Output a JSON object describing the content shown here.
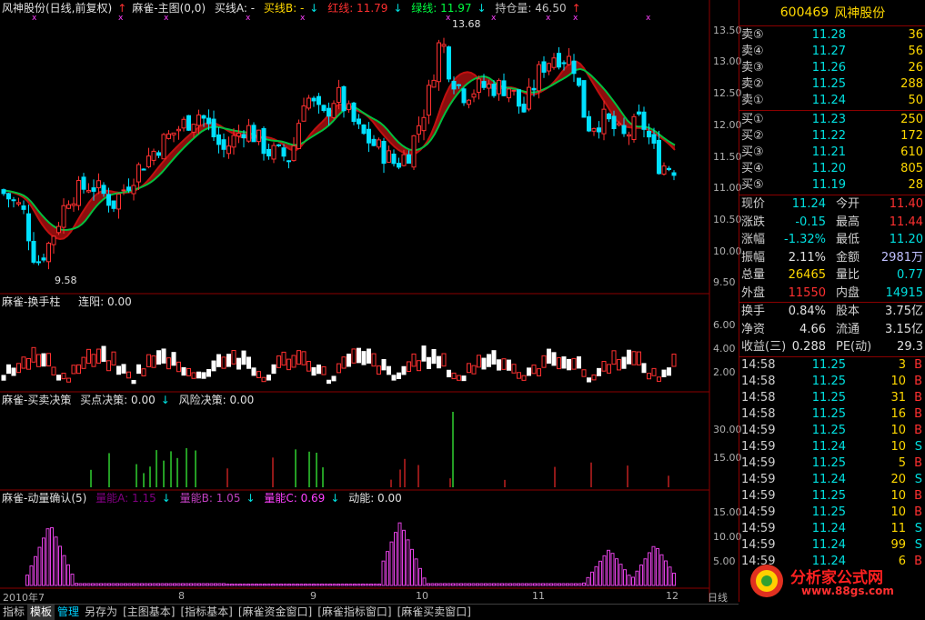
{
  "main_title": {
    "stock": "风神股份(日线,前复权)",
    "indicator": "麻雀-主图(0,0)",
    "items": [
      {
        "label": "买线A: -",
        "color": "#e0e0e0"
      },
      {
        "label": "买线B: -",
        "color": "#ffd800"
      },
      {
        "label": "红线: 11.79",
        "color": "#ff3030"
      },
      {
        "label": "绿线: 11.97",
        "color": "#00ff40"
      },
      {
        "label": "持仓量: 46.50",
        "color": "#c0c0c0"
      }
    ]
  },
  "panel2_title": {
    "name": "麻雀-换手柱",
    "item": "连阳: 0.00"
  },
  "panel3_title": {
    "name": "麻雀-买卖决策",
    "item1": "买点决策: 0.00",
    "item2": "风险决策: 0.00"
  },
  "panel4_title": {
    "name": "麻雀-动量确认(5)",
    "item1": "量能A: 1.15",
    "item2": "量能B: 1.05",
    "item3": "量能C: 0.69",
    "item4": "动能: 0.00"
  },
  "annotations": {
    "high": "13.68",
    "low": "9.58"
  },
  "y_axis_main": [
    "13.50",
    "13.00",
    "12.50",
    "12.00",
    "11.50",
    "11.00",
    "10.50",
    "10.00",
    "9.50"
  ],
  "y_axis_p2": [
    "6.00",
    "4.00",
    "2.00"
  ],
  "y_axis_p3": [
    "30.00",
    "15.00"
  ],
  "y_axis_p4": [
    "15.00",
    "10.00",
    "5.00"
  ],
  "x_axis": [
    "2010年7",
    "8",
    "9",
    "10",
    "11",
    "12"
  ],
  "period_label": "日线",
  "chart_data": {
    "type": "candlestick",
    "x": [
      "2010-07",
      "2010-08",
      "2010-09",
      "2010-10",
      "2010-11",
      "2010-12"
    ],
    "y_range": [
      9.4,
      13.7
    ],
    "indicator_ranges": {
      "turnover": [
        0,
        7.5
      ],
      "decision": [
        0,
        35
      ],
      "momentum": [
        0,
        17
      ]
    },
    "price_high": 13.68,
    "price_low": 9.58,
    "last_close": 11.24
  },
  "quote": {
    "code": "600469",
    "name": "风神股份",
    "sells": [
      {
        "label": "卖⑤",
        "price": "11.28",
        "vol": "36"
      },
      {
        "label": "卖④",
        "price": "11.27",
        "vol": "56"
      },
      {
        "label": "卖③",
        "price": "11.26",
        "vol": "26"
      },
      {
        "label": "卖②",
        "price": "11.25",
        "vol": "288"
      },
      {
        "label": "卖①",
        "price": "11.24",
        "vol": "50"
      }
    ],
    "buys": [
      {
        "label": "买①",
        "price": "11.23",
        "vol": "250"
      },
      {
        "label": "买②",
        "price": "11.22",
        "vol": "172"
      },
      {
        "label": "买③",
        "price": "11.21",
        "vol": "610"
      },
      {
        "label": "买④",
        "price": "11.20",
        "vol": "805"
      },
      {
        "label": "买⑤",
        "price": "11.19",
        "vol": "28"
      }
    ],
    "stats1": [
      {
        "l1": "现价",
        "v1": "11.24",
        "c1": "#00e0e0",
        "l2": "今开",
        "v2": "11.40",
        "c2": "#ff3030"
      },
      {
        "l1": "涨跌",
        "v1": "-0.15",
        "c1": "#00e0e0",
        "l2": "最高",
        "v2": "11.44",
        "c2": "#ff3030"
      },
      {
        "l1": "涨幅",
        "v1": "-1.32%",
        "c1": "#00e0e0",
        "l2": "最低",
        "v2": "11.20",
        "c2": "#00e0e0"
      },
      {
        "l1": "振幅",
        "v1": "2.11%",
        "c1": "#e0e0e0",
        "l2": "金额",
        "v2": "2981万",
        "c2": "#c0c0ff"
      },
      {
        "l1": "总量",
        "v1": "26465",
        "c1": "#ffd800",
        "l2": "量比",
        "v2": "0.77",
        "c2": "#00e0e0"
      },
      {
        "l1": "外盘",
        "v1": "11550",
        "c1": "#ff3030",
        "l2": "内盘",
        "v2": "14915",
        "c2": "#00e0e0"
      }
    ],
    "stats2": [
      {
        "l1": "换手",
        "v1": "0.84%",
        "c1": "#e0e0e0",
        "l2": "股本",
        "v2": "3.75亿",
        "c2": "#e0e0e0"
      },
      {
        "l1": "净资",
        "v1": "4.66",
        "c1": "#e0e0e0",
        "l2": "流通",
        "v2": "3.15亿",
        "c2": "#e0e0e0"
      },
      {
        "l1": "收益(三)",
        "v1": "0.288",
        "c1": "#e0e0e0",
        "l2": "PE(动)",
        "v2": "29.3",
        "c2": "#e0e0e0"
      }
    ],
    "ticks": [
      {
        "t": "14:58",
        "p": "11.25",
        "v": "3",
        "d": "B"
      },
      {
        "t": "14:58",
        "p": "11.25",
        "v": "10",
        "d": "B"
      },
      {
        "t": "14:58",
        "p": "11.25",
        "v": "31",
        "d": "B"
      },
      {
        "t": "14:58",
        "p": "11.25",
        "v": "16",
        "d": "B"
      },
      {
        "t": "14:59",
        "p": "11.25",
        "v": "10",
        "d": "B"
      },
      {
        "t": "14:59",
        "p": "11.24",
        "v": "10",
        "d": "S"
      },
      {
        "t": "14:59",
        "p": "11.25",
        "v": "5",
        "d": "B"
      },
      {
        "t": "14:59",
        "p": "11.24",
        "v": "20",
        "d": "S"
      },
      {
        "t": "14:59",
        "p": "11.25",
        "v": "10",
        "d": "B"
      },
      {
        "t": "14:59",
        "p": "11.25",
        "v": "10",
        "d": "B"
      },
      {
        "t": "14:59",
        "p": "11.24",
        "v": "11",
        "d": "S"
      },
      {
        "t": "14:59",
        "p": "11.24",
        "v": "99",
        "d": "S"
      },
      {
        "t": "14:59",
        "p": "11.24",
        "v": "6",
        "d": "B"
      }
    ]
  },
  "tabs": [
    "指标",
    "模板",
    "管理",
    "另存为",
    "[主图基本]",
    "[指标基本]",
    "[麻雀资金窗口]",
    "[麻雀指标窗口]",
    "[麻雀买卖窗口]"
  ],
  "watermark": {
    "text": "分析家公式网",
    "url": "www.88gs.com"
  }
}
